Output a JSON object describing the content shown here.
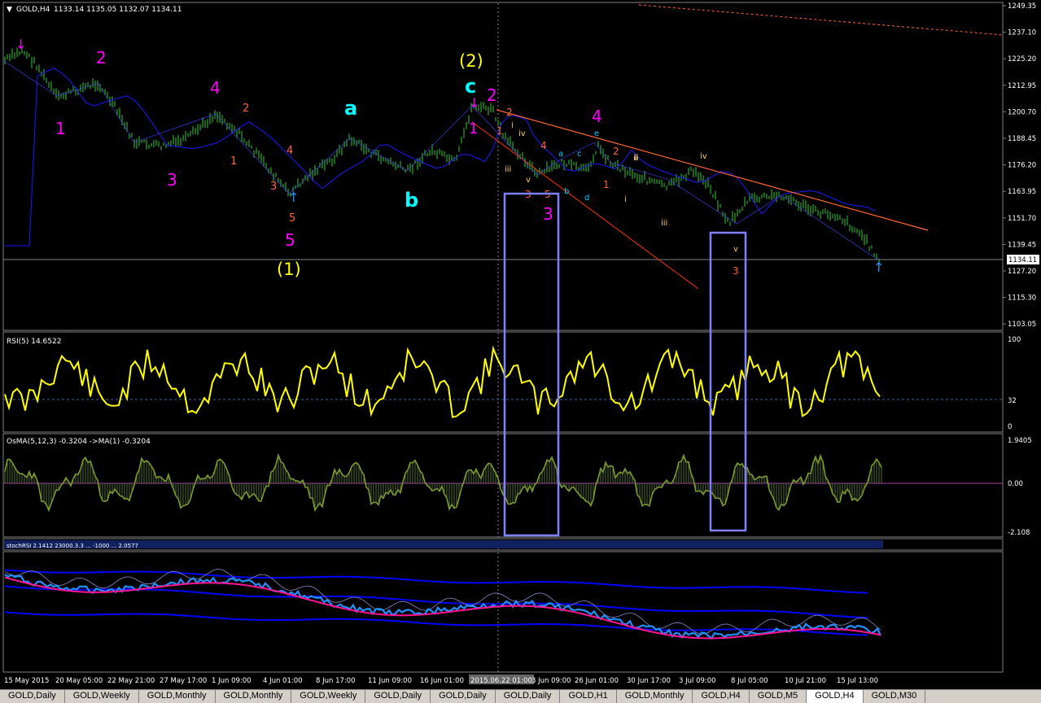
{
  "header": {
    "symbol": "GOLD,H4",
    "ohlc": "1133.14 1135.05 1132.07 1134.11"
  },
  "price_axis": {
    "labels": [
      "1249.35",
      "1237.10",
      "1225.20",
      "1212.95",
      "1200.70",
      "1188.45",
      "1176.20",
      "1163.95",
      "1151.70",
      "1139.45",
      "1127.20",
      "1115.30",
      "1103.05"
    ],
    "current": "1134.11"
  },
  "rsi": {
    "label": "RSI(5) 14.6522",
    "levels": [
      "100",
      "32",
      "0"
    ]
  },
  "osma": {
    "label": "OsMA(5,12,3) -0.3204  ->MA(1) -0.3204",
    "levels": [
      "1.9405",
      "0.00",
      "-2.108"
    ]
  },
  "stoch": {
    "label": "stochRSI 2.1412 23000.3.3 ...  -1000 ... 2.0577"
  },
  "time_axis": {
    "labels": [
      "15 May 2015",
      "20 May 05:00",
      "22 May 21:00",
      "27 May 17:00",
      "1 Jun 09:00",
      "4 Jun 01:00",
      "8 Jun 17:00",
      "11 Jun 09:00",
      "16 Jun 01:00",
      "2015.06.22 01:00",
      "3 Jun 09:00",
      "26 Jun 01:00",
      "30 Jun 17:00",
      "3 Jul 09:00",
      "8 Jul 05:00",
      "10 Jul 21:00",
      "15 Jul 13:00"
    ]
  },
  "wave_labels": {
    "magenta": [
      "1",
      "2",
      "3",
      "4",
      "5",
      "2",
      "1",
      "3",
      "4"
    ],
    "yellow": [
      "(1)",
      "(2)"
    ],
    "cyan": [
      "a",
      "b",
      "c"
    ],
    "orange": [
      "2",
      "1",
      "4",
      "3",
      "5",
      "2",
      "1",
      "3",
      "5",
      "4",
      "2",
      "1",
      "3"
    ],
    "small": [
      "i",
      "ii",
      "iii",
      "iv",
      "v",
      "a",
      "b",
      "c",
      "d",
      "e",
      "i",
      "ii",
      "iii",
      "iv",
      "v"
    ]
  },
  "tabs": [
    "GOLD,Daily",
    "GOLD,Weekly",
    "GOLD,Monthly",
    "GOLD,Monthly",
    "GOLD,Weekly",
    "GOLD,Daily",
    "GOLD,Daily",
    "GOLD,Daily",
    "GOLD,H1",
    "GOLD,Monthly",
    "GOLD,H4",
    "GOLD,M5",
    "GOLD,H4",
    "GOLD,M30"
  ],
  "active_tab_index": 12,
  "colors": {
    "candles": "#32cd32",
    "ma": "#0000ff",
    "rsi": "#ffff00",
    "osma": "#6b8e23",
    "highlight": "#8080ff",
    "trend": "#ff6633",
    "magenta": "#ff00ff",
    "cyan": "#00ffff",
    "yellow": "#ffff00",
    "orange": "#ff6633",
    "stoch_fast": "#1e90ff",
    "stoch_slow": "#ff1493"
  }
}
